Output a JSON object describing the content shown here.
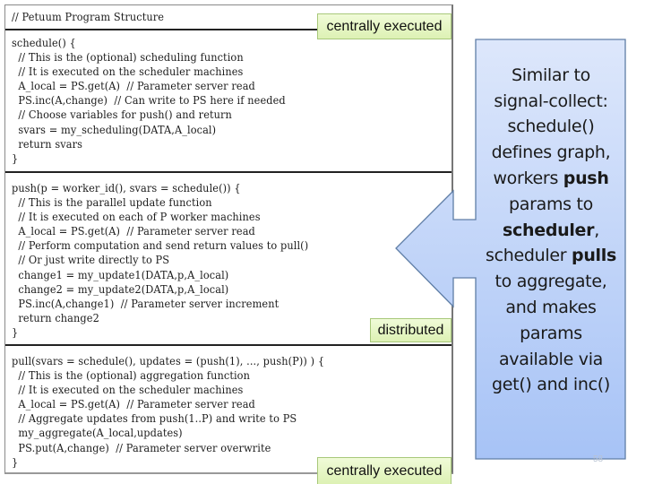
{
  "code_figure": {
    "header": "// Petuum Program Structure",
    "sections": {
      "schedule": [
        "schedule() {",
        "  // This is the (optional) scheduling function",
        "  // It is executed on the scheduler machines",
        "  A_local = PS.get(A)  // Parameter server read",
        "  PS.inc(A,change)  // Can write to PS here if needed",
        "  // Choose variables for push() and return",
        "  svars = my_scheduling(DATA,A_local)",
        "  return svars",
        "}"
      ],
      "push": [
        "push(p = worker_id(), svars = schedule()) {",
        "  // This is the parallel update function",
        "  // It is executed on each of P worker machines",
        "  A_local = PS.get(A)  // Parameter server read",
        "  // Perform computation and send return values to pull()",
        "  // Or just write directly to PS",
        "  change1 = my_update1(DATA,p,A_local)",
        "  change2 = my_update2(DATA,p,A_local)",
        "  PS.inc(A,change1)  // Parameter server increment",
        "  return change2",
        "}"
      ],
      "pull": [
        "pull(svars = schedule(), updates = (push(1), ..., push(P)) ) {",
        "  // This is the (optional) aggregation function",
        "  // It is executed on the scheduler machines",
        "  A_local = PS.get(A)  // Parameter server read",
        "  // Aggregate updates from push(1..P) and write to PS",
        "  my_aggregate(A_local,updates)",
        "  PS.put(A,change)  // Parameter server overwrite",
        "}"
      ]
    }
  },
  "labels": {
    "schedule_label": "centrally executed",
    "push_label": "distributed",
    "pull_label": "centrally executed"
  },
  "callout": {
    "lines": [
      [
        {
          "t": "Similar to",
          "b": false
        }
      ],
      [
        {
          "t": "signal-collect:",
          "b": false
        }
      ],
      [
        {
          "t": "schedule()",
          "b": false
        }
      ],
      [
        {
          "t": "defines graph,",
          "b": false
        }
      ],
      [
        {
          "t": "workers ",
          "b": false
        },
        {
          "t": "push",
          "b": true
        }
      ],
      [
        {
          "t": "params to",
          "b": false
        }
      ],
      [
        {
          "t": "scheduler",
          "b": true
        },
        {
          "t": ",",
          "b": false
        }
      ],
      [
        {
          "t": "scheduler ",
          "b": false
        },
        {
          "t": "pulls",
          "b": true
        }
      ],
      [
        {
          "t": "to aggregate,",
          "b": false
        }
      ],
      [
        {
          "t": "and makes",
          "b": false
        }
      ],
      [
        {
          "t": "params",
          "b": false
        }
      ],
      [
        {
          "t": "available via",
          "b": false
        }
      ],
      [
        {
          "t": "get() and inc()",
          "b": false
        }
      ]
    ],
    "colors": {
      "fill_top": "#dde7fb",
      "fill_bottom": "#a7c3f6",
      "border": "#5f7ea6"
    }
  },
  "label_colors": {
    "fill": "#e6f6c6",
    "border": "#a8c87a"
  },
  "slide": {
    "page_number": "58"
  }
}
